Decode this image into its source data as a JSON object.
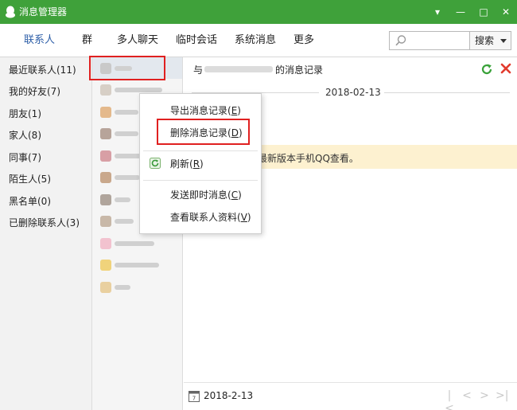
{
  "window": {
    "title": "消息管理器",
    "controls": [
      "▾",
      "—",
      "□",
      "✕"
    ]
  },
  "tabs": [
    {
      "label": "联系人",
      "active": true
    },
    {
      "label": "群"
    },
    {
      "label": "多人聊天"
    },
    {
      "label": "临时会话"
    },
    {
      "label": "系统消息"
    },
    {
      "label": "更多"
    }
  ],
  "search": {
    "placeholder": "",
    "button_label": "搜索"
  },
  "categories": [
    {
      "label": "最近联系人(11)",
      "selected": true
    },
    {
      "label": "我的好友(7)"
    },
    {
      "label": "朋友(1)"
    },
    {
      "label": "家人(8)"
    },
    {
      "label": "同事(7)"
    },
    {
      "label": "陌生人(5)"
    },
    {
      "label": "黑名单(0)"
    },
    {
      "label": "已删除联系人(3)"
    }
  ],
  "message": {
    "header_prefix": "与",
    "header_suffix": "的消息记录",
    "date_divider": "2018-02-13",
    "notice_text": "最新版本手机QQ查看。",
    "footer_date": "2018-2-13"
  },
  "context_menu": {
    "export": {
      "label": "导出消息记录",
      "key": "E"
    },
    "delete": {
      "label": "删除消息记录",
      "key": "D"
    },
    "refresh": {
      "label": "刷新",
      "key": "R"
    },
    "send": {
      "label": "发送即时消息",
      "key": "C"
    },
    "profile": {
      "label": "查看联系人资料",
      "key": "V"
    }
  },
  "colors": {
    "titlebar": "#3fa13a",
    "active_tab": "#2e5fa8",
    "highlight_box": "#e02020",
    "notice_bg": "#fdf1d0"
  }
}
